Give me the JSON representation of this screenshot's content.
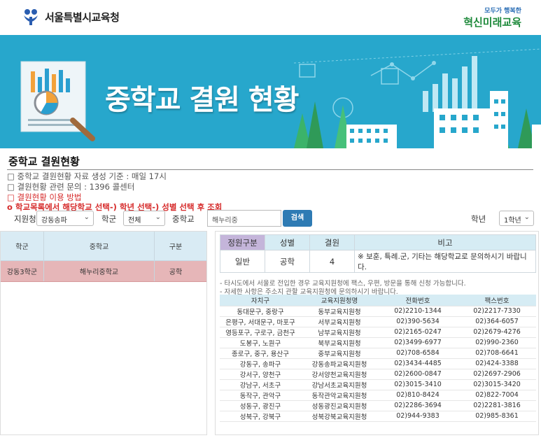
{
  "header": {
    "org_name": "서울특별시교육청",
    "slogan_top": "모두가 행복한",
    "slogan_main": "혁신미래교육"
  },
  "banner": {
    "title": "중학교 결원 현황"
  },
  "page": {
    "title": "중학교 결원현황",
    "notices": [
      "□ 중학교 결원현황 자료 생성 기준 : 매일 17시",
      "□ 결원현황 관련 문의 : 1396 콜센터",
      "□ 결원현황 이용 방법",
      "o 학교목록에서 해당학교 선택-) 학년 선택-) 성별 선택 후 조회"
    ]
  },
  "filter": {
    "district_label": "지원청",
    "district_value": "강동송파",
    "school_district_label": "학군",
    "school_district_value": "전체",
    "school_label": "중학교",
    "school_value": "해누리중",
    "search_label": "검색",
    "grade_label": "학년",
    "grade_value": "1학년"
  },
  "school_list": {
    "headers": [
      "학군",
      "중학교",
      "구분"
    ],
    "rows": [
      {
        "district": "강동3학군",
        "school": "해누리중학교",
        "type": "공학"
      }
    ]
  },
  "vacancy": {
    "headers": [
      "정원구분",
      "성별",
      "결원",
      "비고"
    ],
    "row": {
      "category": "일반",
      "gender": "공학",
      "vacancies": "4",
      "note": "※ 보훈, 특례.군, 기타는 해당학교로 문의하시기 바랍니다."
    }
  },
  "info_lines": [
    "- 타시도에서 서울로 전입한 경우 교육지원청에 팩스, 우편, 방문을 통해 신청 가능합니다.",
    "- 자세한 사항은 주소지 관할 교육지원청에 문의하시기 바랍니다."
  ],
  "contacts": {
    "headers": [
      "자치구",
      "교육지원청명",
      "전화번호",
      "팩스번호"
    ],
    "rows": [
      [
        "동대문구, 중랑구",
        "동부교육지원청",
        "02)2210-1344",
        "02)2217-7330"
      ],
      [
        "은평구, 서대문구, 마포구",
        "서부교육지원청",
        "02)390-5634",
        "02)364-6057"
      ],
      [
        "영등포구, 구로구, 금천구",
        "남부교육지원청",
        "02)2165-0247",
        "02)2679-4276"
      ],
      [
        "도봉구, 노원구",
        "북부교육지원청",
        "02)3499-6977",
        "02)990-2360"
      ],
      [
        "종로구, 중구, 용산구",
        "중부교육지원청",
        "02)708-6584",
        "02)708-6641"
      ],
      [
        "강동구, 송파구",
        "강동송파교육지원청",
        "02)3434-4485",
        "02)424-3388"
      ],
      [
        "강서구, 양천구",
        "강서양천교육지원청",
        "02)2600-0847",
        "02)2697-2906"
      ],
      [
        "강남구, 서초구",
        "강남서초교육지원청",
        "02)3015-3410",
        "02)3015-3420"
      ],
      [
        "동작구, 관악구",
        "동작관악교육지원청",
        "02)810-8424",
        "02)822-7004"
      ],
      [
        "성동구, 광진구",
        "성동광진교육지원청",
        "02)2286-3694",
        "02)2281-3816"
      ],
      [
        "성북구, 강북구",
        "성북강북교육지원청",
        "02)944-9383",
        "02)985-8361"
      ]
    ]
  }
}
